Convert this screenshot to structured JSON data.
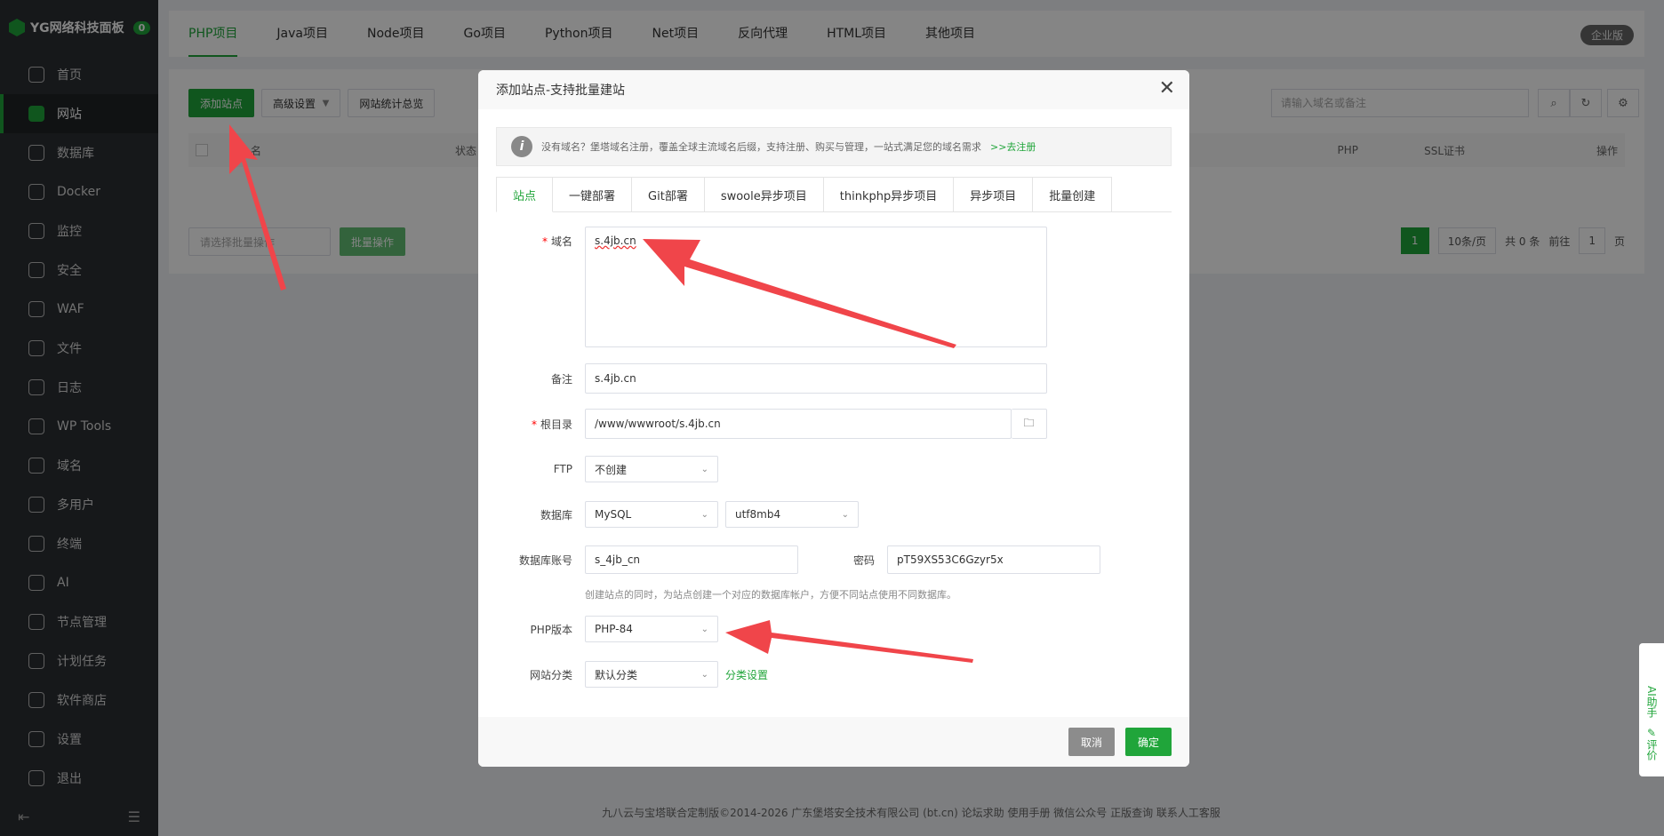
{
  "brand": {
    "title": "YG网络科技面板",
    "badge": "0"
  },
  "sidebar": {
    "items": [
      {
        "label": "首页",
        "icon": "home-icon"
      },
      {
        "label": "网站",
        "icon": "website-icon",
        "active": true
      },
      {
        "label": "数据库",
        "icon": "database-icon"
      },
      {
        "label": "Docker",
        "icon": "docker-icon"
      },
      {
        "label": "监控",
        "icon": "monitor-icon"
      },
      {
        "label": "安全",
        "icon": "shield-icon"
      },
      {
        "label": "WAF",
        "icon": "waf-icon"
      },
      {
        "label": "文件",
        "icon": "folder-icon"
      },
      {
        "label": "日志",
        "icon": "log-icon"
      },
      {
        "label": "WP Tools",
        "icon": "wordpress-icon"
      },
      {
        "label": "域名",
        "icon": "globe-icon"
      },
      {
        "label": "多用户",
        "icon": "users-icon"
      },
      {
        "label": "终端",
        "icon": "terminal-icon"
      },
      {
        "label": "AI",
        "icon": "ai-icon"
      },
      {
        "label": "节点管理",
        "icon": "node-icon"
      },
      {
        "label": "计划任务",
        "icon": "calendar-icon"
      },
      {
        "label": "软件商店",
        "icon": "store-icon"
      },
      {
        "label": "设置",
        "icon": "gear-icon"
      },
      {
        "label": "退出",
        "icon": "logout-icon"
      }
    ]
  },
  "top_tabs": [
    "PHP项目",
    "Java项目",
    "Node项目",
    "Go项目",
    "Python项目",
    "Net项目",
    "反向代理",
    "HTML项目",
    "其他项目"
  ],
  "enterprise_badge": "企业版",
  "toolbar": {
    "add_site": "添加站点",
    "advanced": "高级设置",
    "stats": "网站统计总览"
  },
  "search": {
    "placeholder": "请输入域名或备注"
  },
  "table_headers": {
    "name": "名",
    "status": "状态",
    "php": "PHP",
    "ssl": "SSL证书",
    "ops": "操作"
  },
  "batch": {
    "select": "请选择批量操作",
    "button": "批量操作"
  },
  "pager": {
    "page": "1",
    "per_page": "10条/页",
    "total": "共 0 条",
    "goto": "前往",
    "goto_value": "1",
    "unit": "页"
  },
  "footer": "九八云与宝塔联合定制版©2014-2026 广东堡塔安全技术有限公司 (bt.cn)   论坛求助   使用手册   微信公众号   正版查询   联系人工客服",
  "modal": {
    "title": "添加站点-支持批量建站",
    "notice": "没有域名？堡塔域名注册，覆盖全球主流域名后缀，支持注册、购买与管理，一站式满足您的域名需求",
    "notice_link": ">>去注册",
    "tabs": [
      "站点",
      "一键部署",
      "Git部署",
      "swoole异步项目",
      "thinkphp异步项目",
      "异步项目",
      "批量创建"
    ],
    "domain_label": "域名",
    "domain_value": "s.4jb.cn",
    "remark_label": "备注",
    "remark_value": "s.4jb.cn",
    "root_label": "根目录",
    "root_value": "/www/wwwroot/s.4jb.cn",
    "ftp_label": "FTP",
    "ftp_value": "不创建",
    "db_label": "数据库",
    "db_type": "MySQL",
    "db_charset": "utf8mb4",
    "db_user_label": "数据库账号",
    "db_user": "s_4jb_cn",
    "db_pass_label": "密码",
    "db_pass": "pT59XS53C6Gzyr5x",
    "db_hint": "创建站点的同时，为站点创建一个对应的数据库帐户，方便不同站点使用不同数据库。",
    "php_label": "PHP版本",
    "php_value": "PHP-84",
    "category_label": "网站分类",
    "category_value": "默认分类",
    "category_link": "分类设置",
    "cancel": "取消",
    "confirm": "确定"
  },
  "float": {
    "ai": "AI助手",
    "review": "评价"
  },
  "colors": {
    "accent": "#20a53a",
    "sidebar": "#2b2f33",
    "arrow": "#f0454a"
  }
}
